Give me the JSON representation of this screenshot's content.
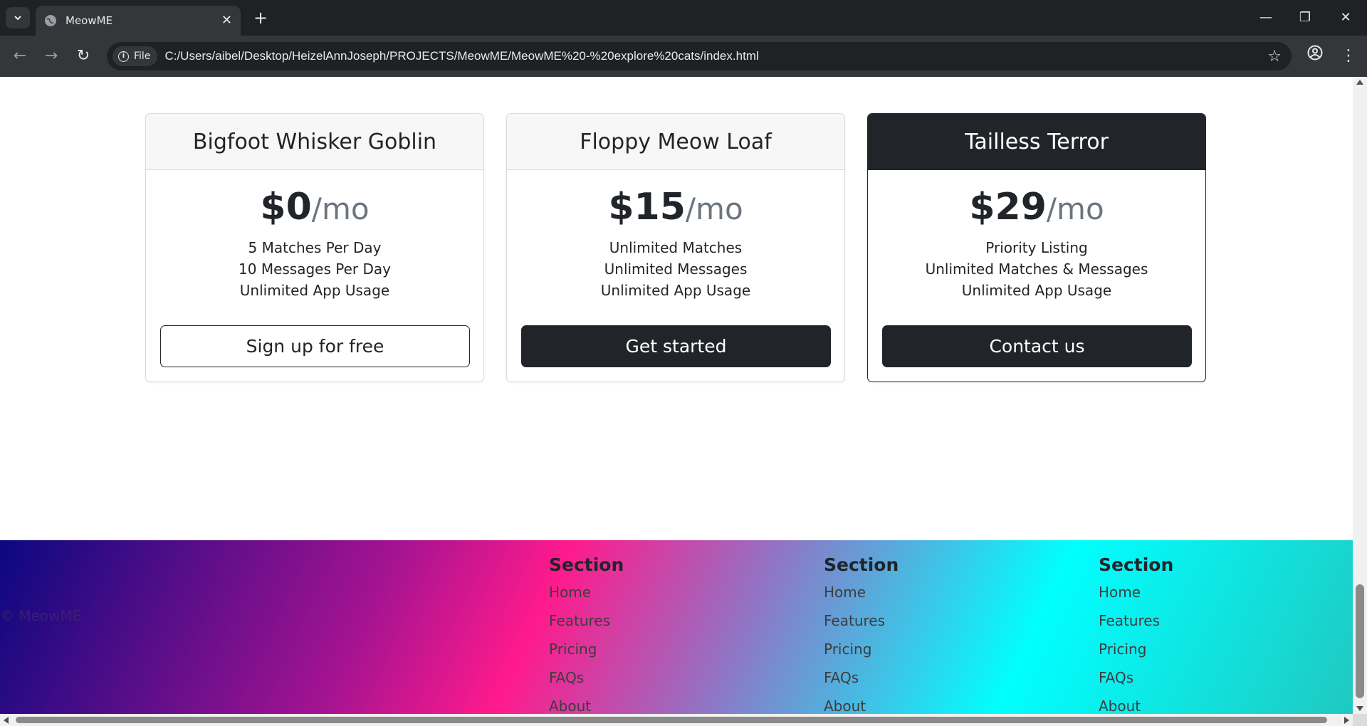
{
  "browser": {
    "tab_title": "MeowME",
    "url_chip": "File",
    "url": "C:/Users/aibel/Desktop/HeizelAnnJoseph/PROJECTS/MeowME/MeowME%20-%20explore%20cats/index.html"
  },
  "pricing": [
    {
      "title": "Bigfoot Whisker Goblin",
      "price": "$0",
      "period": "/mo",
      "features": [
        "5 Matches Per Day",
        "10 Messages Per Day",
        "Unlimited App Usage"
      ],
      "button": "Sign up for free"
    },
    {
      "title": "Floppy Meow Loaf",
      "price": "$15",
      "period": "/mo",
      "features": [
        "Unlimited Matches",
        "Unlimited Messages",
        "Unlimited App Usage"
      ],
      "button": "Get started"
    },
    {
      "title": "Tailless Terror",
      "price": "$29",
      "period": "/mo",
      "features": [
        "Priority Listing",
        "Unlimited Matches & Messages",
        "Unlimited App Usage"
      ],
      "button": "Contact us"
    }
  ],
  "footer": {
    "copyright": "© MeowME",
    "columns": [
      {
        "heading": "Section",
        "links": [
          "Home",
          "Features",
          "Pricing",
          "FAQs",
          "About"
        ]
      },
      {
        "heading": "Section",
        "links": [
          "Home",
          "Features",
          "Pricing",
          "FAQs",
          "About"
        ]
      },
      {
        "heading": "Section",
        "links": [
          "Home",
          "Features",
          "Pricing",
          "FAQs",
          "About"
        ]
      }
    ]
  },
  "colors": {
    "dark": "#212529",
    "chrome_bg": "#202124",
    "toolbar_bg": "#35363a"
  },
  "icons": [
    "chevron-down-icon",
    "globe-icon",
    "close-icon",
    "plus-icon",
    "minimize-icon",
    "restore-icon",
    "back-icon",
    "forward-icon",
    "reload-icon",
    "info-icon",
    "star-icon",
    "profile-icon",
    "menu-icon"
  ]
}
